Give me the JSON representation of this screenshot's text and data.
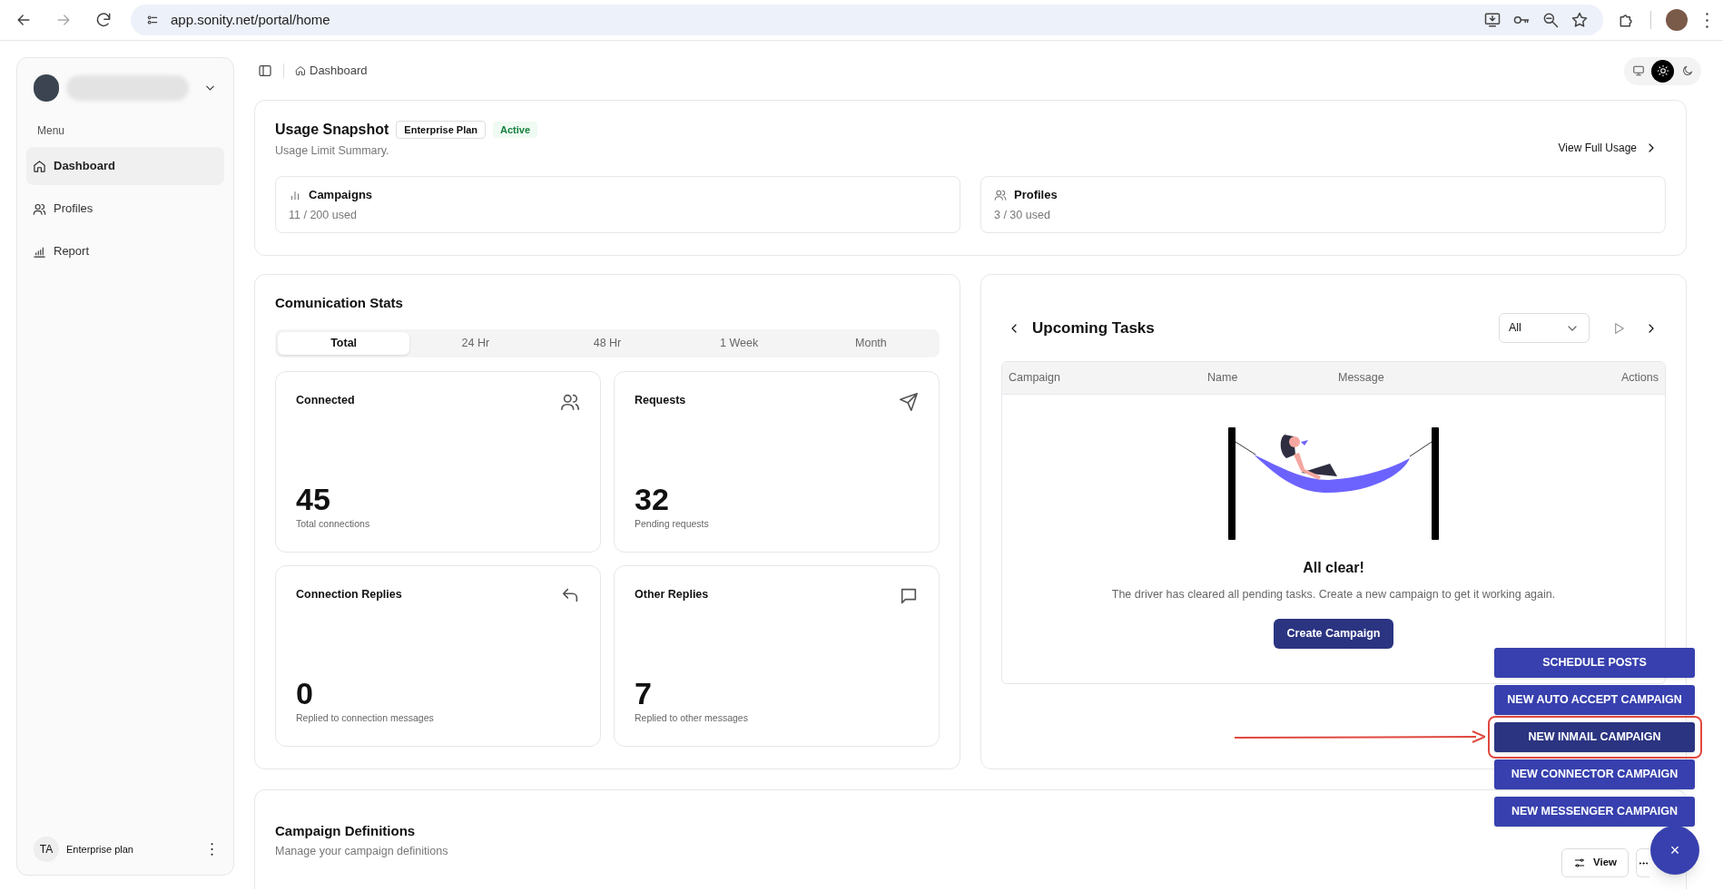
{
  "browser": {
    "url": "app.sonity.net/portal/home"
  },
  "sidebar": {
    "menu_label": "Menu",
    "items": [
      {
        "label": "Dashboard",
        "selected": true
      },
      {
        "label": "Profiles",
        "selected": false
      },
      {
        "label": "Report",
        "selected": false
      }
    ],
    "footer": {
      "initials": "TA",
      "plan": "Enterprise plan"
    }
  },
  "header": {
    "breadcrumb": "Dashboard",
    "theme_modes": [
      {
        "selected": false
      },
      {
        "selected": true
      },
      {
        "selected": false
      }
    ]
  },
  "usage": {
    "title": "Usage Snapshot",
    "plan_badge": "Enterprise Plan",
    "status_badge": "Active",
    "subtitle": "Usage Limit Summary.",
    "link": "View Full Usage",
    "cards": [
      {
        "title": "Campaigns",
        "value": "11 / 200 used"
      },
      {
        "title": "Profiles",
        "value": "3 / 30 used"
      }
    ]
  },
  "stats": {
    "title": "Comunication Stats",
    "tabs": [
      {
        "label": "Total",
        "selected": true
      },
      {
        "label": "24 Hr",
        "selected": false
      },
      {
        "label": "48 Hr",
        "selected": false
      },
      {
        "label": "1 Week",
        "selected": false
      },
      {
        "label": "Month",
        "selected": false
      }
    ],
    "cards": [
      {
        "title": "Connected",
        "value": "45",
        "caption": "Total connections"
      },
      {
        "title": "Requests",
        "value": "32",
        "caption": "Pending requests"
      },
      {
        "title": "Connection Replies",
        "value": "0",
        "caption": "Replied to connection messages"
      },
      {
        "title": "Other Replies",
        "value": "7",
        "caption": "Replied to other messages"
      }
    ]
  },
  "tasks": {
    "title": "Upcoming Tasks",
    "filter": "All",
    "columns": [
      "Campaign",
      "Name",
      "Message",
      "Actions"
    ],
    "empty": {
      "title": "All clear!",
      "text": "The driver has cleared all pending tasks. Create a new campaign to get it working again.",
      "button": "Create Campaign"
    }
  },
  "definitions": {
    "title": "Campaign Definitions",
    "subtitle": "Manage your campaign definitions",
    "view_button": "View"
  },
  "fab": {
    "close": "×",
    "actions": [
      {
        "label": "SCHEDULE POSTS",
        "highlighted": false
      },
      {
        "label": "NEW AUTO ACCEPT CAMPAIGN",
        "highlighted": false
      },
      {
        "label": "NEW INMAIL CAMPAIGN",
        "highlighted": true
      },
      {
        "label": "NEW CONNECTOR CAMPAIGN",
        "highlighted": false
      },
      {
        "label": "NEW MESSENGER CAMPAIGN",
        "highlighted": false
      }
    ]
  }
}
